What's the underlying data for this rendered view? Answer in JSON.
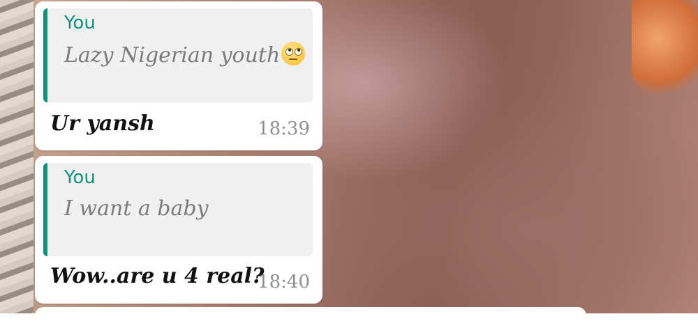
{
  "messages": [
    {
      "quote_author": "You",
      "quote_text": "Lazy Nigerian youth",
      "quote_emoji": "face-with-rolling-eyes-icon",
      "text": "Ur yansh",
      "time": "18:39"
    },
    {
      "quote_author": "You",
      "quote_text": "I want a baby",
      "text": "Wow..are u 4 real?",
      "time": "18:40"
    }
  ],
  "colors": {
    "quote_accent": "#12907a",
    "quote_author": "#14907b",
    "bubble": "#ffffff",
    "quote_bg": "#f0f0f0"
  }
}
